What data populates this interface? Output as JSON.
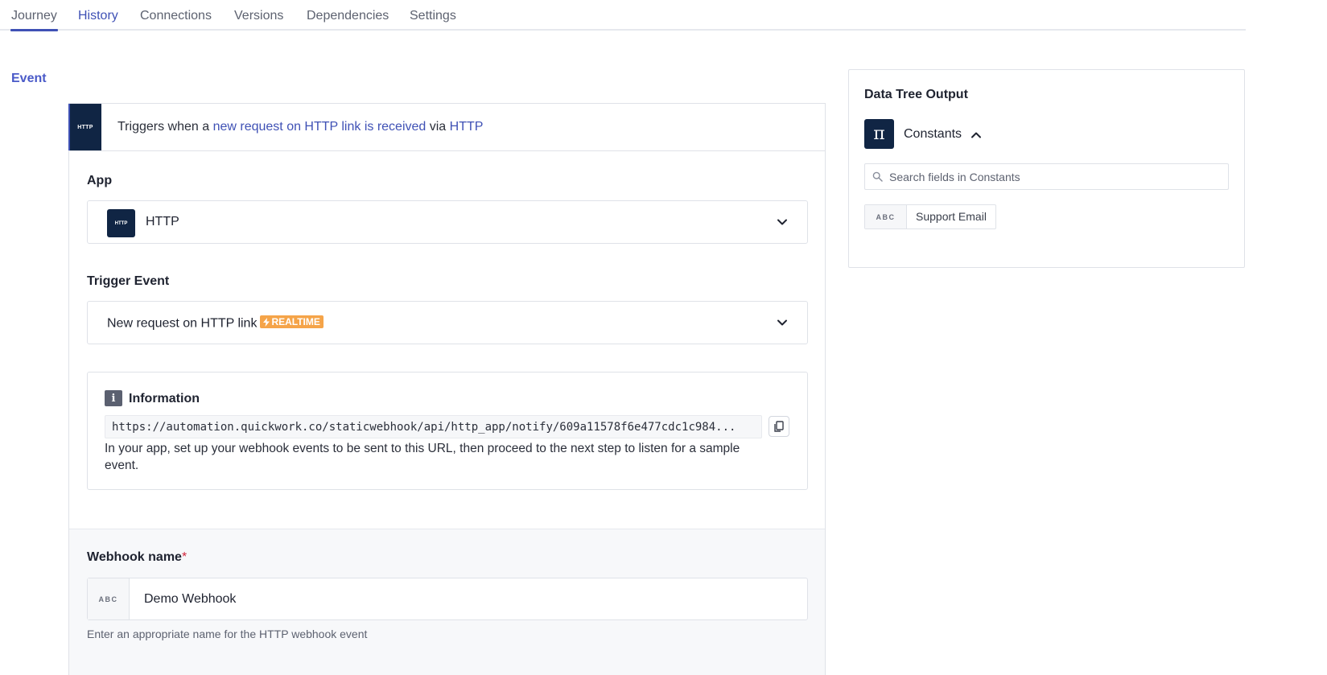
{
  "tabs": [
    {
      "label": "Journey"
    },
    {
      "label": "History"
    },
    {
      "label": "Connections"
    },
    {
      "label": "Versions"
    },
    {
      "label": "Dependencies"
    },
    {
      "label": "Settings"
    }
  ],
  "section": {
    "label": "Event"
  },
  "trigger": {
    "badge": "HTTP",
    "prefix": "Triggers when a ",
    "event_link": "new request on HTTP link is received",
    "via": " via ",
    "app_link": "HTTP"
  },
  "app_field": {
    "label": "App",
    "icon_text": "HTTP",
    "value": "HTTP"
  },
  "trigger_event_field": {
    "label": "Trigger Event",
    "value": "New request on HTTP link",
    "badge": "REALTIME"
  },
  "information": {
    "title": "Information",
    "url": "https://automation.quickwork.co/staticwebhook/api/http_app/notify/609a11578f6e477cdc1c984...",
    "description": "In your app, set up your webhook events to be sent to this URL, then proceed to the next step to listen for a sample event."
  },
  "webhook_name": {
    "label": "Webhook name",
    "required_mark": "*",
    "type_tag": "ABC",
    "value": "Demo Webhook",
    "hint": "Enter an appropriate name for the HTTP webhook event"
  },
  "data_tree": {
    "title": "Data Tree Output",
    "group_label": "Constants",
    "search_placeholder": "Search fields in Constants",
    "fields": [
      {
        "type": "ABC",
        "label": "Support Email"
      }
    ]
  },
  "colors": {
    "accent": "#3f51b5",
    "icon_bg": "#102544",
    "realtime": "#f5a449"
  }
}
